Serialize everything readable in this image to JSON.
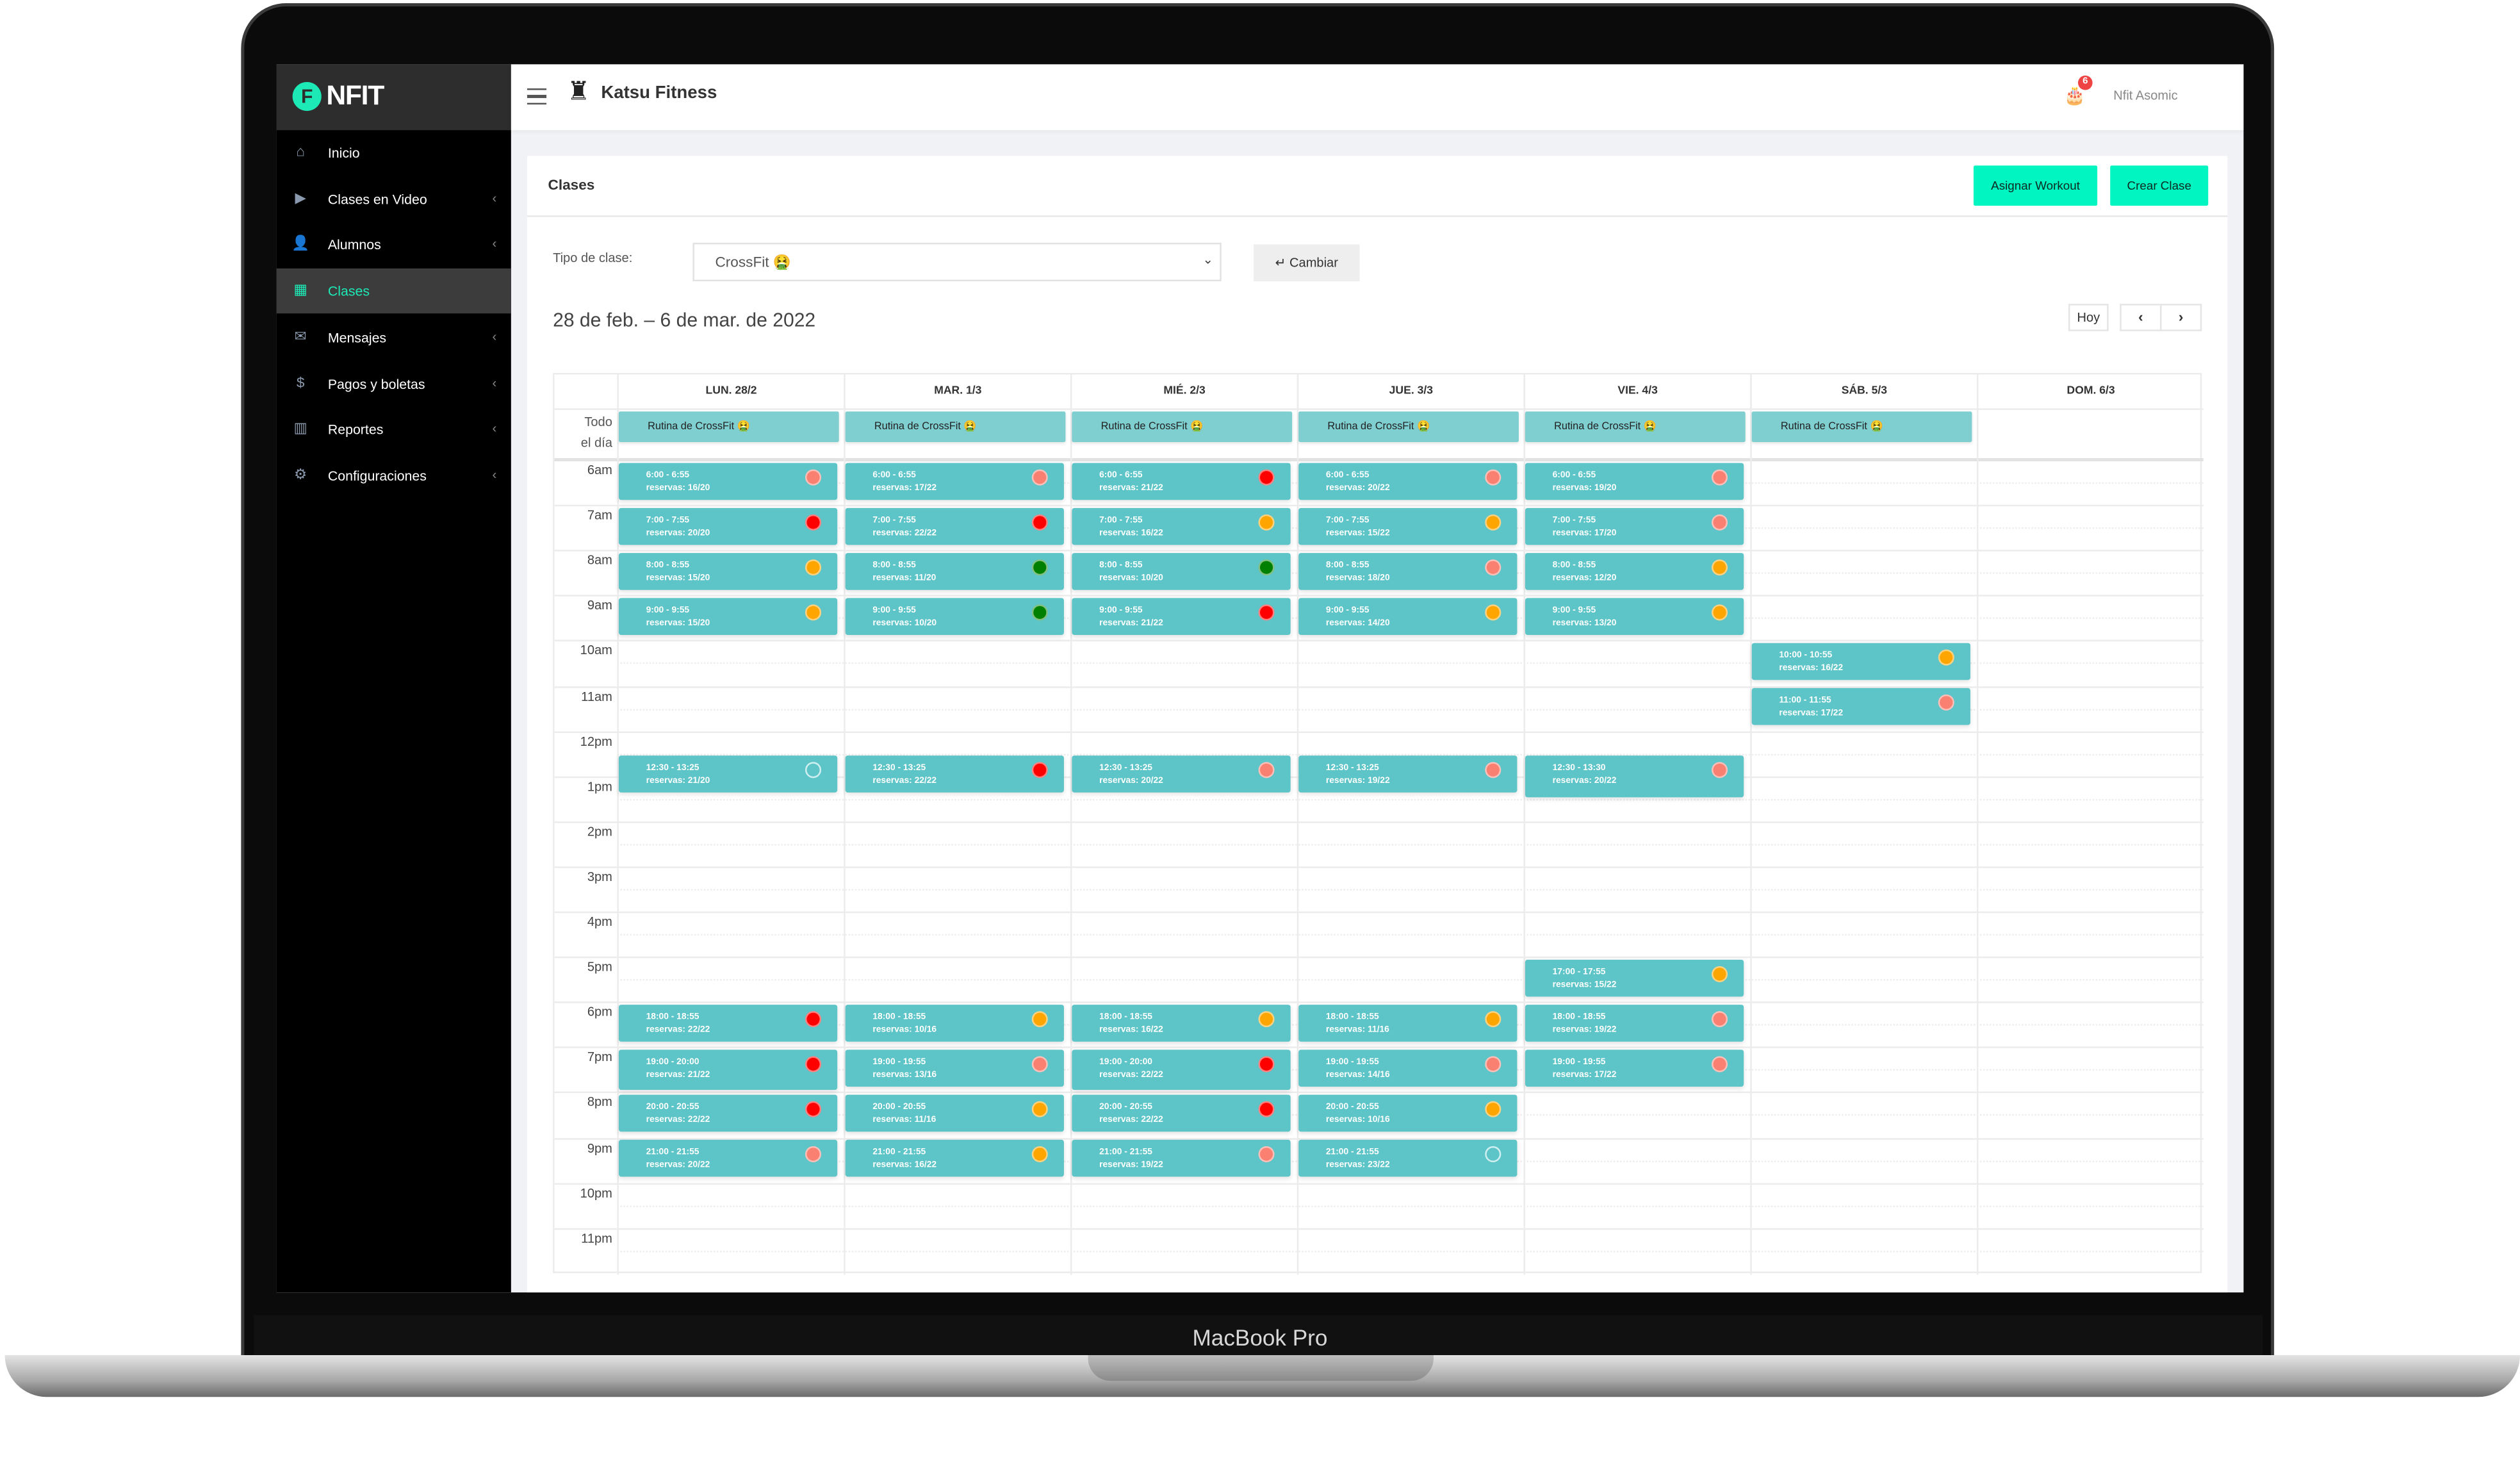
{
  "device_label": "MacBook Pro",
  "sidebar": {
    "logo": "NFIT",
    "items": [
      {
        "label": "Inicio",
        "icon": "home-icon",
        "glyph": "⌂",
        "chevron": false,
        "active": false
      },
      {
        "label": "Clases en Video",
        "icon": "youtube-icon",
        "glyph": "▶",
        "chevron": true,
        "active": false
      },
      {
        "label": "Alumnos",
        "icon": "user-icon",
        "glyph": "👤",
        "chevron": true,
        "active": false
      },
      {
        "label": "Clases",
        "icon": "calendar-icon",
        "glyph": "▦",
        "chevron": false,
        "active": true
      },
      {
        "label": "Mensajes",
        "icon": "envelope-icon",
        "glyph": "✉",
        "chevron": true,
        "active": false
      },
      {
        "label": "Pagos y boletas",
        "icon": "dollar-icon",
        "glyph": "$",
        "chevron": true,
        "active": false
      },
      {
        "label": "Reportes",
        "icon": "bar-chart-icon",
        "glyph": "▥",
        "chevron": true,
        "active": false
      },
      {
        "label": "Configuraciones",
        "icon": "gear-icon",
        "glyph": "⚙",
        "chevron": true,
        "active": false
      }
    ],
    "chevron_glyph": "‹"
  },
  "topbar": {
    "brand": "Katsu Fitness",
    "notification_count": "6",
    "user_name": "Nfit Asomic",
    "avatar_letter": "F"
  },
  "page": {
    "title": "Clases",
    "assign_workout": "Asignar Workout",
    "create_class": "Crear Clase",
    "class_type_label": "Tipo de clase:",
    "class_type_value": "CrossFit 🤮",
    "change_button": "↵ Cambiar",
    "date_range": "28 de feb. – 6 de mar. de 2022",
    "today_button": "Hoy",
    "prev": "‹",
    "next": "›"
  },
  "colors": {
    "accent": "#1de9b6",
    "button": "#00f5c0",
    "event": "#5dc4c7",
    "salmon": "#fa8072",
    "red": "#ff0000",
    "orange": "#ffa500",
    "green": "#008000"
  },
  "calendar": {
    "all_day_label_1": "Todo",
    "all_day_label_2": "el día",
    "hours": [
      "6am",
      "7am",
      "8am",
      "9am",
      "10am",
      "11am",
      "12pm",
      "1pm",
      "2pm",
      "3pm",
      "4pm",
      "5pm",
      "6pm",
      "7pm",
      "8pm",
      "9pm",
      "10pm",
      "11pm"
    ],
    "days": [
      {
        "header": "LUN. 28/2",
        "all_day": "Rutina de CrossFit 🤮",
        "events": [
          {
            "time": "6:00 - 6:55",
            "reservas": "reservas: 16/20",
            "status": "salmon"
          },
          {
            "time": "7:00 - 7:55",
            "reservas": "reservas: 20/20",
            "status": "red"
          },
          {
            "time": "8:00 - 8:55",
            "reservas": "reservas: 15/20",
            "status": "orange"
          },
          {
            "time": "9:00 - 9:55",
            "reservas": "reservas: 15/20",
            "status": "orange"
          },
          {
            "time": "12:30 - 13:25",
            "reservas": "reservas: 21/20",
            "status": "empty"
          },
          {
            "time": "18:00 - 18:55",
            "reservas": "reservas: 22/22",
            "status": "red"
          },
          {
            "time": "19:00 - 20:00",
            "reservas": "reservas: 21/22",
            "status": "red"
          },
          {
            "time": "20:00 - 20:55",
            "reservas": "reservas: 22/22",
            "status": "red"
          },
          {
            "time": "21:00 - 21:55",
            "reservas": "reservas: 20/22",
            "status": "salmon"
          }
        ]
      },
      {
        "header": "MAR. 1/3",
        "all_day": "Rutina de CrossFit 🤮",
        "events": [
          {
            "time": "6:00 - 6:55",
            "reservas": "reservas: 17/22",
            "status": "salmon"
          },
          {
            "time": "7:00 - 7:55",
            "reservas": "reservas: 22/22",
            "status": "red"
          },
          {
            "time": "8:00 - 8:55",
            "reservas": "reservas: 11/20",
            "status": "green"
          },
          {
            "time": "9:00 - 9:55",
            "reservas": "reservas: 10/20",
            "status": "green"
          },
          {
            "time": "12:30 - 13:25",
            "reservas": "reservas: 22/22",
            "status": "red"
          },
          {
            "time": "18:00 - 18:55",
            "reservas": "reservas: 10/16",
            "status": "orange"
          },
          {
            "time": "19:00 - 19:55",
            "reservas": "reservas: 13/16",
            "status": "salmon"
          },
          {
            "time": "20:00 - 20:55",
            "reservas": "reservas: 11/16",
            "status": "orange"
          },
          {
            "time": "21:00 - 21:55",
            "reservas": "reservas: 16/22",
            "status": "orange"
          }
        ]
      },
      {
        "header": "MIÉ. 2/3",
        "all_day": "Rutina de CrossFit 🤮",
        "events": [
          {
            "time": "6:00 - 6:55",
            "reservas": "reservas: 21/22",
            "status": "red"
          },
          {
            "time": "7:00 - 7:55",
            "reservas": "reservas: 16/22",
            "status": "orange"
          },
          {
            "time": "8:00 - 8:55",
            "reservas": "reservas: 10/20",
            "status": "green"
          },
          {
            "time": "9:00 - 9:55",
            "reservas": "reservas: 21/22",
            "status": "red"
          },
          {
            "time": "12:30 - 13:25",
            "reservas": "reservas: 20/22",
            "status": "salmon"
          },
          {
            "time": "18:00 - 18:55",
            "reservas": "reservas: 16/22",
            "status": "orange"
          },
          {
            "time": "19:00 - 20:00",
            "reservas": "reservas: 22/22",
            "status": "red"
          },
          {
            "time": "20:00 - 20:55",
            "reservas": "reservas: 22/22",
            "status": "red"
          },
          {
            "time": "21:00 - 21:55",
            "reservas": "reservas: 19/22",
            "status": "salmon"
          }
        ]
      },
      {
        "header": "JUE. 3/3",
        "all_day": "Rutina de CrossFit 🤮",
        "events": [
          {
            "time": "6:00 - 6:55",
            "reservas": "reservas: 20/22",
            "status": "salmon"
          },
          {
            "time": "7:00 - 7:55",
            "reservas": "reservas: 15/22",
            "status": "orange"
          },
          {
            "time": "8:00 - 8:55",
            "reservas": "reservas: 18/20",
            "status": "salmon"
          },
          {
            "time": "9:00 - 9:55",
            "reservas": "reservas: 14/20",
            "status": "orange"
          },
          {
            "time": "12:30 - 13:25",
            "reservas": "reservas: 19/22",
            "status": "salmon"
          },
          {
            "time": "18:00 - 18:55",
            "reservas": "reservas: 11/16",
            "status": "orange"
          },
          {
            "time": "19:00 - 19:55",
            "reservas": "reservas: 14/16",
            "status": "salmon"
          },
          {
            "time": "20:00 - 20:55",
            "reservas": "reservas: 10/16",
            "status": "orange"
          },
          {
            "time": "21:00 - 21:55",
            "reservas": "reservas: 23/22",
            "status": "empty"
          }
        ]
      },
      {
        "header": "VIE. 4/3",
        "all_day": "Rutina de CrossFit 🤮",
        "events": [
          {
            "time": "6:00 - 6:55",
            "reservas": "reservas: 19/20",
            "status": "salmon"
          },
          {
            "time": "7:00 - 7:55",
            "reservas": "reservas: 17/20",
            "status": "salmon"
          },
          {
            "time": "8:00 - 8:55",
            "reservas": "reservas: 12/20",
            "status": "orange"
          },
          {
            "time": "9:00 - 9:55",
            "reservas": "reservas: 13/20",
            "status": "orange"
          },
          {
            "time": "12:30 - 13:30",
            "reservas": "reservas: 20/22",
            "status": "salmon"
          },
          {
            "time": "17:00 - 17:55",
            "reservas": "reservas: 15/22",
            "status": "orange"
          },
          {
            "time": "18:00 - 18:55",
            "reservas": "reservas: 19/22",
            "status": "salmon"
          },
          {
            "time": "19:00 - 19:55",
            "reservas": "reservas: 17/22",
            "status": "salmon"
          }
        ]
      },
      {
        "header": "SÁB. 5/3",
        "all_day": "Rutina de CrossFit 🤮",
        "events": [
          {
            "time": "10:00 - 10:55",
            "reservas": "reservas: 16/22",
            "status": "orange"
          },
          {
            "time": "11:00 - 11:55",
            "reservas": "reservas: 17/22",
            "status": "salmon"
          }
        ]
      },
      {
        "header": "DOM. 6/3",
        "all_day": null,
        "events": []
      }
    ]
  }
}
